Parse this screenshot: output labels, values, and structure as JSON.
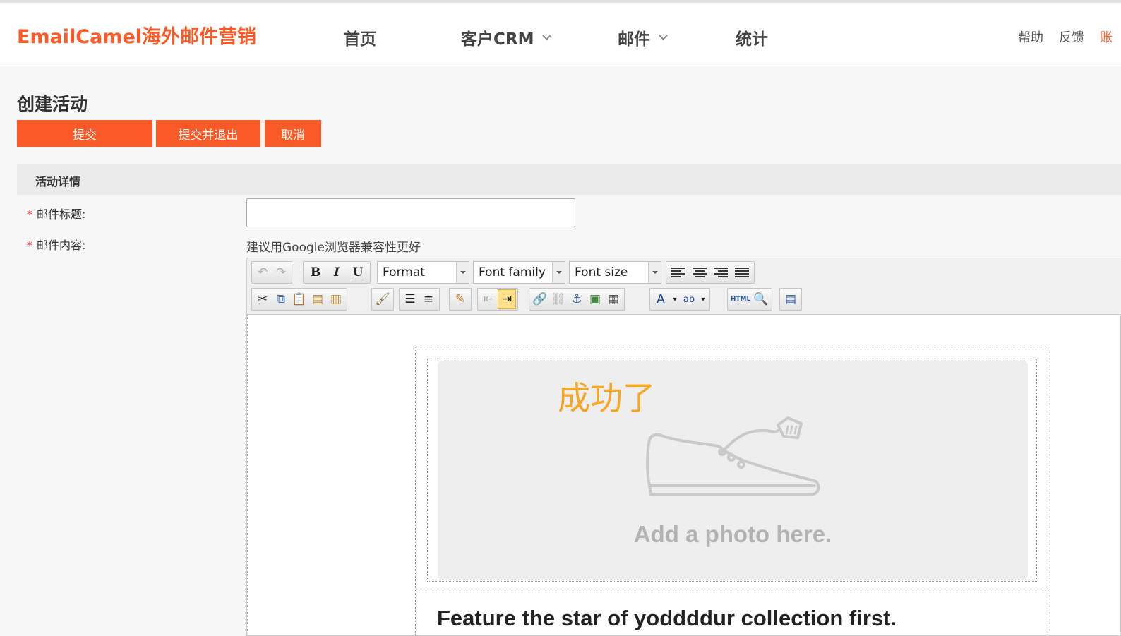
{
  "header": {
    "logo": "EmailCamel海外邮件营销",
    "nav": [
      {
        "label": "首页"
      },
      {
        "label": "客户CRM"
      },
      {
        "label": "邮件"
      },
      {
        "label": "统计"
      }
    ],
    "links": {
      "help": "帮助",
      "feedback": "反馈",
      "account": "账"
    }
  },
  "page": {
    "title": "创建活动",
    "buttons": {
      "submit": "提交",
      "submit_exit": "提交并退出",
      "cancel": "取消"
    }
  },
  "section": {
    "title": "活动详情",
    "required_mark": "*",
    "subject_label": "邮件标题:",
    "subject_value": "",
    "content_label": "邮件内容:",
    "hint": "建议用Google浏览器兼容性更好"
  },
  "toolbar": {
    "bold": "B",
    "italic": "I",
    "underline": "U",
    "format": "Format",
    "font_family": "Font family",
    "font_size": "Font size",
    "html_label": "HTML"
  },
  "editor_content": {
    "overlay_text": "成功了",
    "photo_placeholder": "Add a photo here.",
    "feature_heading": "Feature the star of yoddddur collection first."
  },
  "colors": {
    "brand": "#fa5a27",
    "success_text": "#f5a623"
  }
}
